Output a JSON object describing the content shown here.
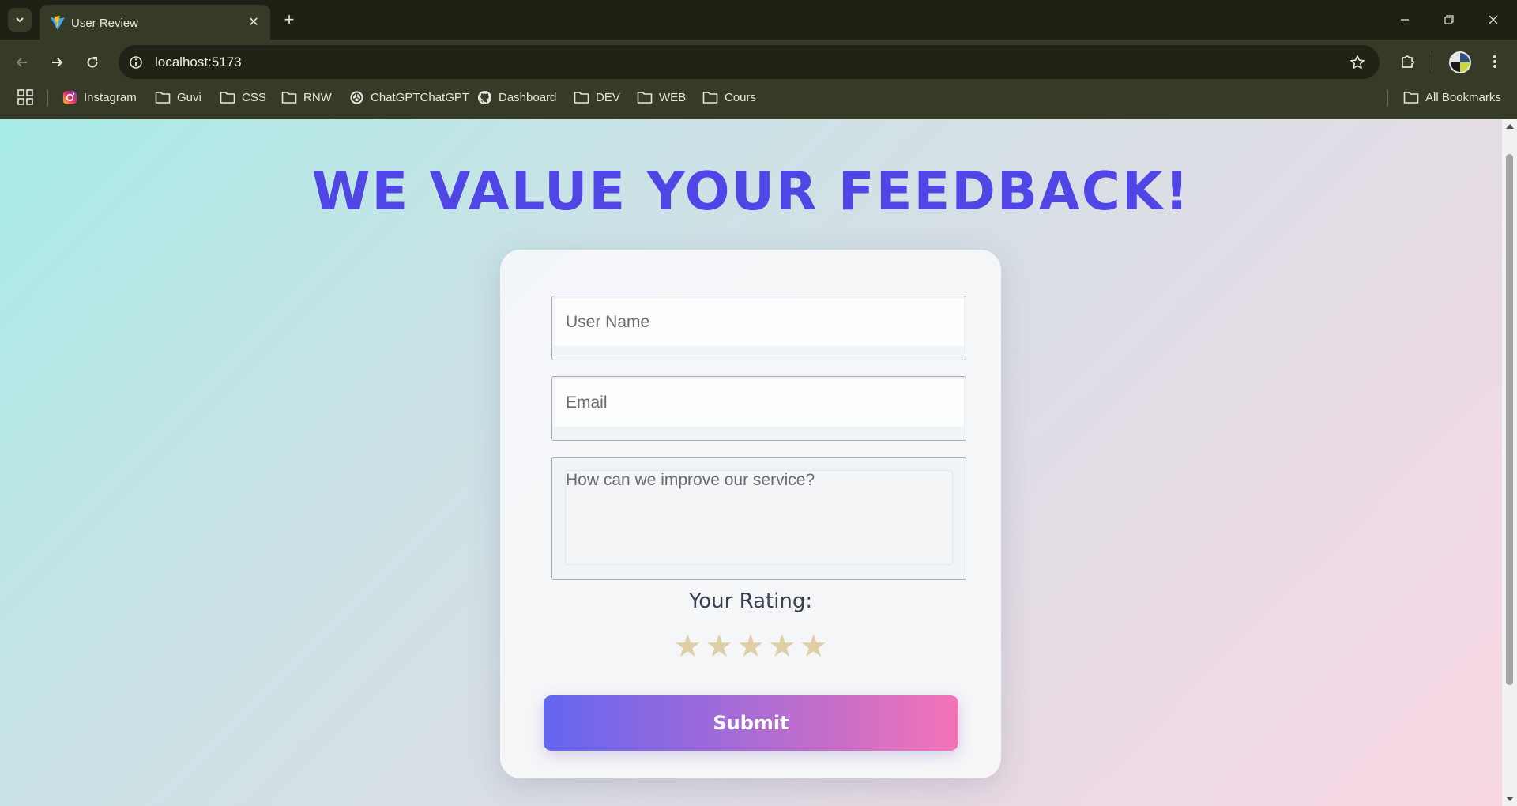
{
  "browser": {
    "tab": {
      "title": "User Review",
      "close_symbol": "✕"
    },
    "new_tab_symbol": "+",
    "address_bar": {
      "url": "localhost:5173"
    },
    "bookmarks": [
      {
        "label": "Instagram",
        "icon": "instagram-icon"
      },
      {
        "label": "Guvi",
        "icon": "folder-icon"
      },
      {
        "label": "CSS",
        "icon": "folder-icon"
      },
      {
        "label": "RNW",
        "icon": "folder-icon"
      },
      {
        "label": "ChatGPTChatGPT",
        "icon": "chatgpt-icon"
      },
      {
        "label": "Dashboard",
        "icon": "github-icon"
      },
      {
        "label": "DEV",
        "icon": "folder-icon"
      },
      {
        "label": "WEB",
        "icon": "folder-icon"
      },
      {
        "label": "Cours",
        "icon": "folder-icon"
      }
    ],
    "all_bookmarks_label": "All Bookmarks"
  },
  "page": {
    "heading": "WE VALUE YOUR FEEDBACK!",
    "form": {
      "username_placeholder": "User Name",
      "username_value": "",
      "email_placeholder": "Email",
      "email_value": "",
      "feedback_placeholder": "How can we improve our service?",
      "feedback_value": "",
      "rating_label": "Your Rating:",
      "rating": {
        "value": 0,
        "max": 5,
        "star_symbol": "★",
        "star_color": "#e0cfa6"
      },
      "submit_label": "Submit"
    }
  },
  "colors": {
    "heading": "#4f46e5",
    "submit_gradient_start": "#6366f1",
    "submit_gradient_end": "#f472b6",
    "browser_frame": "#353b27"
  }
}
